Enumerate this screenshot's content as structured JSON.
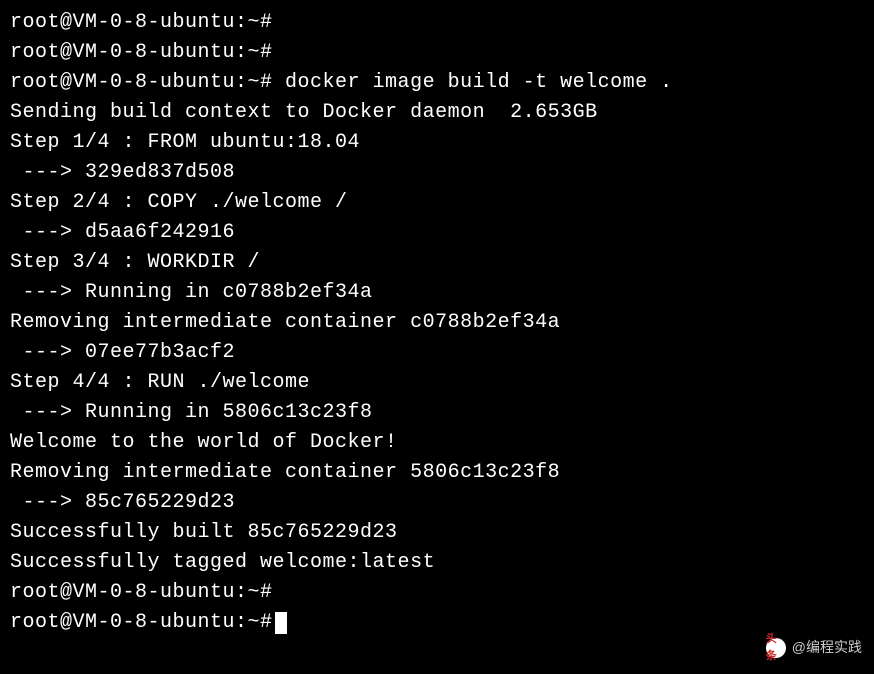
{
  "terminal": {
    "lines": [
      "root@VM-0-8-ubuntu:~#",
      "root@VM-0-8-ubuntu:~#",
      "root@VM-0-8-ubuntu:~# docker image build -t welcome .",
      "Sending build context to Docker daemon  2.653GB",
      "Step 1/4 : FROM ubuntu:18.04",
      " ---> 329ed837d508",
      "Step 2/4 : COPY ./welcome /",
      " ---> d5aa6f242916",
      "Step 3/4 : WORKDIR /",
      " ---> Running in c0788b2ef34a",
      "Removing intermediate container c0788b2ef34a",
      " ---> 07ee77b3acf2",
      "Step 4/4 : RUN ./welcome",
      " ---> Running in 5806c13c23f8",
      "Welcome to the world of Docker!",
      "Removing intermediate container 5806c13c23f8",
      " ---> 85c765229d23",
      "Successfully built 85c765229d23",
      "Successfully tagged welcome:latest",
      "root@VM-0-8-ubuntu:~#",
      "root@VM-0-8-ubuntu:~#"
    ]
  },
  "watermark": {
    "logo_text": "头条",
    "handle": "@编程实践"
  }
}
